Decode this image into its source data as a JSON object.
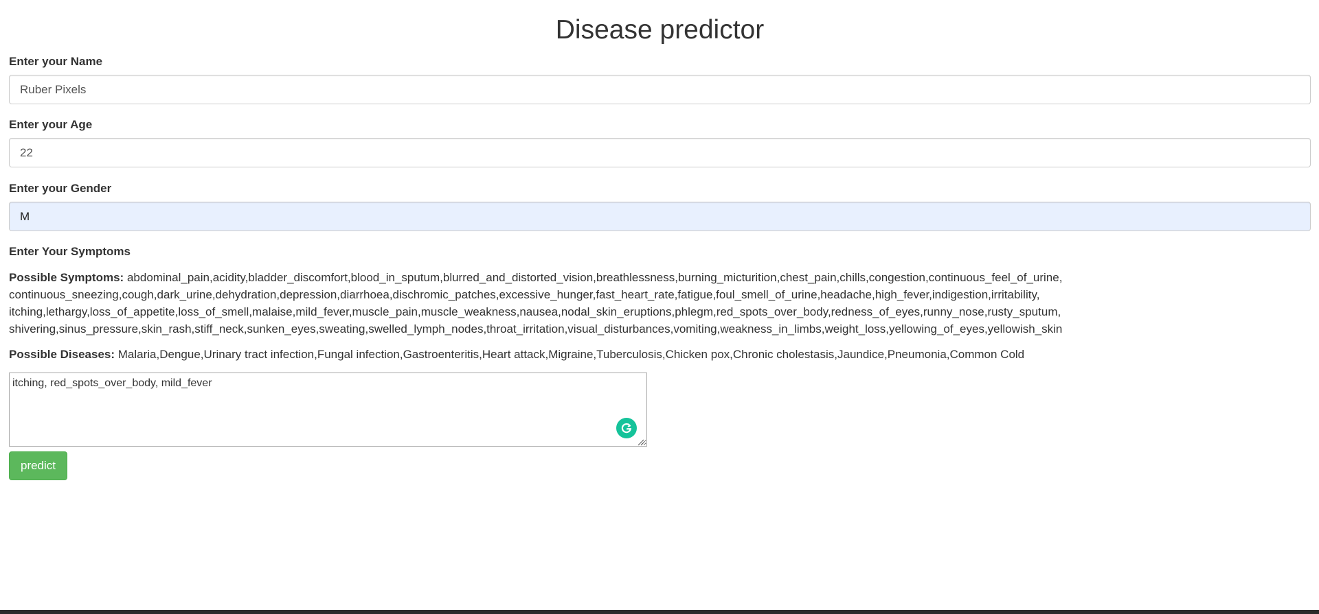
{
  "page": {
    "title": "Disease predictor"
  },
  "form": {
    "name": {
      "label": "Enter your Name",
      "value": "Ruber Pixels"
    },
    "age": {
      "label": "Enter your Age",
      "value": "22"
    },
    "gender": {
      "label": "Enter your Gender",
      "value": "M"
    },
    "symptoms": {
      "label": "Enter Your Symptoms",
      "possible_symptoms_label": "Possible Symptoms:",
      "possible_symptoms_lines": [
        "abdominal_pain,acidity,bladder_discomfort,blood_in_sputum,blurred_and_distorted_vision,breathlessness,burning_micturition,chest_pain,chills,congestion,continuous_feel_of_urine,",
        "continuous_sneezing,cough,dark_urine,dehydration,depression,diarrhoea,dischromic_patches,excessive_hunger,fast_heart_rate,fatigue,foul_smell_of_urine,headache,high_fever,indigestion,irritability,",
        "itching,lethargy,loss_of_appetite,loss_of_smell,malaise,mild_fever,muscle_pain,muscle_weakness,nausea,nodal_skin_eruptions,phlegm,red_spots_over_body,redness_of_eyes,runny_nose,rusty_sputum,",
        "shivering,sinus_pressure,skin_rash,stiff_neck,sunken_eyes,sweating,swelled_lymph_nodes,throat_irritation,visual_disturbances,vomiting,weakness_in_limbs,weight_loss,yellowing_of_eyes,yellowish_skin"
      ],
      "possible_diseases_label": "Possible Diseases:",
      "possible_diseases": "Malaria,Dengue,Urinary tract infection,Fungal infection,Gastroenteritis,Heart attack,Migraine,Tuberculosis,Chicken pox,Chronic cholestasis,Jaundice,Pneumonia,Common Cold",
      "value": "itching, red_spots_over_body, mild_fever"
    },
    "submit_label": "predict"
  },
  "colors": {
    "button": "#5cb85c",
    "autofill": "#e8f0fe",
    "grammarly": "#15c39a"
  },
  "icons": {
    "grammarly": "grammarly-icon",
    "resize": "resize-grip-icon"
  }
}
